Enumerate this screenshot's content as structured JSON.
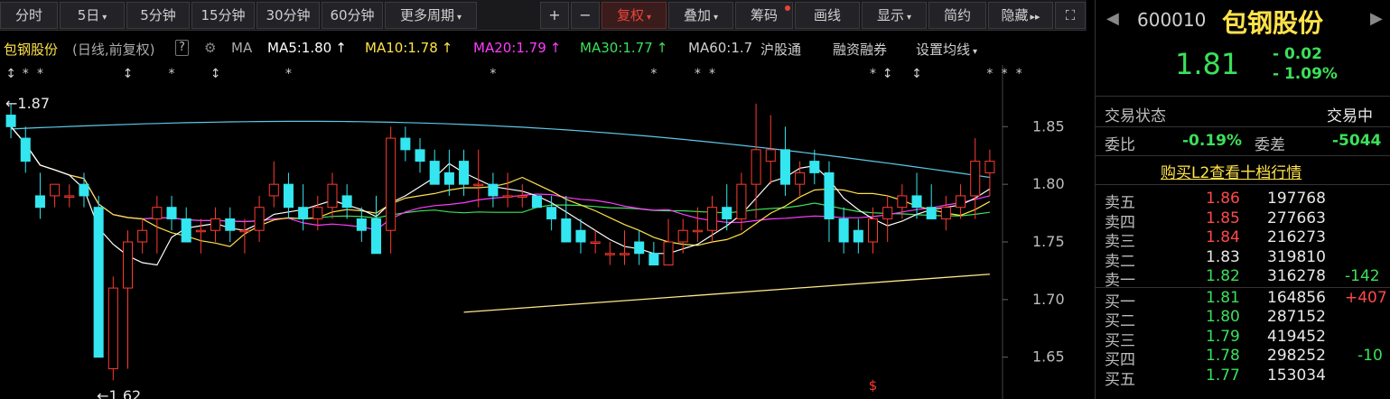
{
  "toolbar": {
    "items": [
      {
        "label": "分时",
        "caret": false
      },
      {
        "label": "5日",
        "caret": true
      },
      {
        "label": "5分钟",
        "caret": false
      },
      {
        "label": "15分钟",
        "caret": false
      },
      {
        "label": "30分钟",
        "caret": false
      },
      {
        "label": "60分钟",
        "caret": false
      },
      {
        "label": "更多周期",
        "caret": true
      }
    ],
    "plus": "+",
    "minus": "−",
    "fuquan": "复权",
    "diejia": "叠加",
    "chouma": "筹码",
    "huaxian": "画线",
    "xianshi": "显示",
    "jianyue": "简约",
    "yincang": "隐藏",
    "yincang_arrow": "▸▸",
    "expand_icon": "⛶"
  },
  "indicators": {
    "stock_name": "包钢股份",
    "mode": "(日线,前复权)",
    "help": "?",
    "gear": "⚙",
    "ma": "MA",
    "ma5": "MA5:1.80",
    "ma10": "MA10:1.78",
    "ma20": "MA20:1.79",
    "ma30": "MA30:1.77",
    "ma60": "MA60:1.7",
    "up_arrow": "↑",
    "hgt": "沪股通",
    "rzrq": "融资融券",
    "settings": "设置均线",
    "colors": {
      "ma5": "#ffffff",
      "ma10": "#ffe24a",
      "ma20": "#ff3cff",
      "ma30": "#3ce05a",
      "ma60": "#cfcfcf"
    }
  },
  "chart_data": {
    "type": "candlestick",
    "ylim": [
      1.62,
      1.88
    ],
    "yticks": [
      "1.85",
      "1.80",
      "1.75",
      "1.70",
      "1.65"
    ],
    "ytick_values": [
      1.85,
      1.8,
      1.75,
      1.7,
      1.65
    ],
    "high_label": "←1.87",
    "low_label": "←1.62",
    "high_value": 1.87,
    "low_value": 1.62,
    "candles": [
      [
        1.86,
        1.87,
        1.84,
        1.85
      ],
      [
        1.84,
        1.85,
        1.81,
        1.82
      ],
      [
        1.79,
        1.81,
        1.77,
        1.78
      ],
      [
        1.79,
        1.8,
        1.78,
        1.8
      ],
      [
        1.79,
        1.8,
        1.78,
        1.79
      ],
      [
        1.8,
        1.81,
        1.78,
        1.79
      ],
      [
        1.78,
        1.79,
        1.65,
        1.65
      ],
      [
        1.64,
        1.72,
        1.63,
        1.71
      ],
      [
        1.71,
        1.76,
        1.64,
        1.75
      ],
      [
        1.75,
        1.77,
        1.74,
        1.76
      ],
      [
        1.77,
        1.79,
        1.74,
        1.78
      ],
      [
        1.78,
        1.79,
        1.76,
        1.77
      ],
      [
        1.77,
        1.78,
        1.75,
        1.75
      ],
      [
        1.76,
        1.77,
        1.74,
        1.76
      ],
      [
        1.76,
        1.78,
        1.75,
        1.77
      ],
      [
        1.77,
        1.78,
        1.75,
        1.76
      ],
      [
        1.76,
        1.77,
        1.74,
        1.76
      ],
      [
        1.76,
        1.79,
        1.75,
        1.78
      ],
      [
        1.79,
        1.82,
        1.78,
        1.8
      ],
      [
        1.8,
        1.81,
        1.77,
        1.78
      ],
      [
        1.78,
        1.8,
        1.76,
        1.77
      ],
      [
        1.77,
        1.79,
        1.76,
        1.78
      ],
      [
        1.78,
        1.81,
        1.77,
        1.8
      ],
      [
        1.79,
        1.8,
        1.77,
        1.78
      ],
      [
        1.77,
        1.78,
        1.75,
        1.76
      ],
      [
        1.77,
        1.79,
        1.74,
        1.74
      ],
      [
        1.76,
        1.85,
        1.74,
        1.84
      ],
      [
        1.84,
        1.85,
        1.82,
        1.83
      ],
      [
        1.83,
        1.84,
        1.81,
        1.82
      ],
      [
        1.82,
        1.83,
        1.8,
        1.8
      ],
      [
        1.81,
        1.83,
        1.79,
        1.8
      ],
      [
        1.82,
        1.83,
        1.79,
        1.8
      ],
      [
        1.8,
        1.83,
        1.78,
        1.8
      ],
      [
        1.8,
        1.81,
        1.78,
        1.79
      ],
      [
        1.79,
        1.81,
        1.78,
        1.79
      ],
      [
        1.79,
        1.8,
        1.78,
        1.79
      ],
      [
        1.79,
        1.79,
        1.78,
        1.78
      ],
      [
        1.78,
        1.79,
        1.76,
        1.77
      ],
      [
        1.77,
        1.79,
        1.75,
        1.75
      ],
      [
        1.76,
        1.77,
        1.74,
        1.75
      ],
      [
        1.75,
        1.76,
        1.74,
        1.75
      ],
      [
        1.74,
        1.75,
        1.73,
        1.74
      ],
      [
        1.74,
        1.76,
        1.73,
        1.74
      ],
      [
        1.75,
        1.76,
        1.73,
        1.74
      ],
      [
        1.74,
        1.75,
        1.73,
        1.73
      ],
      [
        1.73,
        1.77,
        1.73,
        1.75
      ],
      [
        1.75,
        1.77,
        1.74,
        1.76
      ],
      [
        1.76,
        1.78,
        1.75,
        1.76
      ],
      [
        1.76,
        1.79,
        1.75,
        1.78
      ],
      [
        1.78,
        1.8,
        1.76,
        1.77
      ],
      [
        1.77,
        1.81,
        1.76,
        1.8
      ],
      [
        1.8,
        1.87,
        1.77,
        1.83
      ],
      [
        1.82,
        1.86,
        1.8,
        1.83
      ],
      [
        1.83,
        1.85,
        1.79,
        1.8
      ],
      [
        1.8,
        1.82,
        1.79,
        1.81
      ],
      [
        1.82,
        1.83,
        1.8,
        1.81
      ],
      [
        1.81,
        1.82,
        1.75,
        1.77
      ],
      [
        1.77,
        1.78,
        1.74,
        1.75
      ],
      [
        1.76,
        1.77,
        1.74,
        1.75
      ],
      [
        1.75,
        1.78,
        1.74,
        1.77
      ],
      [
        1.77,
        1.79,
        1.75,
        1.78
      ],
      [
        1.78,
        1.8,
        1.77,
        1.79
      ],
      [
        1.79,
        1.81,
        1.77,
        1.78
      ],
      [
        1.78,
        1.8,
        1.77,
        1.77
      ],
      [
        1.77,
        1.79,
        1.76,
        1.78
      ],
      [
        1.78,
        1.8,
        1.77,
        1.79
      ],
      [
        1.79,
        1.84,
        1.77,
        1.82
      ],
      [
        1.81,
        1.83,
        1.79,
        1.82
      ]
    ],
    "markers": [
      "↕",
      "*",
      "*",
      "",
      "",
      "",
      "",
      "",
      "↕",
      "",
      "",
      "*",
      "",
      "",
      "↕",
      "",
      "",
      "",
      "",
      "*",
      "",
      "",
      "",
      "",
      "",
      "",
      "",
      "",
      "",
      "",
      "",
      "",
      "",
      "*",
      "",
      "",
      "",
      "",
      "",
      "",
      "",
      "",
      "",
      "",
      "*",
      "",
      "",
      "*",
      "*",
      "",
      "",
      "",
      "",
      "",
      "",
      "",
      "",
      "",
      "",
      "*",
      "↕",
      "",
      "↕",
      "",
      "",
      "",
      "",
      "*",
      "*",
      "*"
    ],
    "ma_colors": {
      "ma5": "#ffffff",
      "ma10": "#ffe24a",
      "ma20": "#ff3cff",
      "ma30": "#3ce05a",
      "ma60": "#5ec8e8"
    },
    "s_marker": "$"
  },
  "panel": {
    "code": "600010",
    "name": "包钢股份",
    "price": "1.81",
    "change": "- 0.02",
    "change_pct": "- 1.09%",
    "status_label": "交易状态",
    "status_value": "交易中",
    "weibi_label": "委比",
    "weibi_value": "-0.19%",
    "weicha_label": "委差",
    "weicha_value": "-5044",
    "l2_link": "购买L2查看十档行情",
    "asks": [
      {
        "label": "卖五",
        "price": "1.86",
        "vol": "197768",
        "delta": ""
      },
      {
        "label": "卖四",
        "price": "1.85",
        "vol": "277663",
        "delta": ""
      },
      {
        "label": "卖三",
        "price": "1.84",
        "vol": "216273",
        "delta": ""
      },
      {
        "label": "卖二",
        "price": "1.83",
        "vol": "319810",
        "delta": ""
      },
      {
        "label": "卖一",
        "price": "1.82",
        "vol": "316278",
        "delta": "-142"
      }
    ],
    "bids": [
      {
        "label": "买一",
        "price": "1.81",
        "vol": "164856",
        "delta": "+407"
      },
      {
        "label": "买二",
        "price": "1.80",
        "vol": "287152",
        "delta": ""
      },
      {
        "label": "买三",
        "price": "1.79",
        "vol": "419452",
        "delta": ""
      },
      {
        "label": "买四",
        "price": "1.78",
        "vol": "298252",
        "delta": "-10"
      },
      {
        "label": "买五",
        "price": "1.77",
        "vol": "153034",
        "delta": ""
      }
    ]
  }
}
